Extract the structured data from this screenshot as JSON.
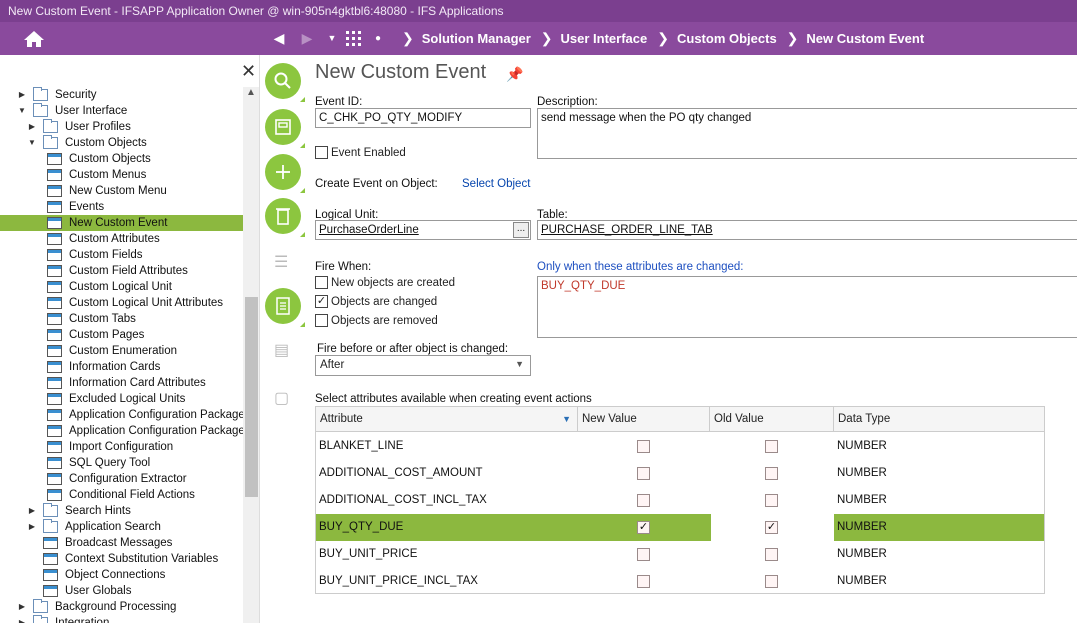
{
  "window": {
    "title": "New Custom Event - IFSAPP Application Owner @ win-905n4gktbl6:48080 - IFS Applications"
  },
  "nav": {
    "breadcrumbs": [
      "Solution Manager",
      "User Interface",
      "Custom Objects",
      "New Custom Event"
    ]
  },
  "tree": {
    "items": [
      {
        "label": "Security",
        "level": 1,
        "kind": "folder",
        "toggle": "▶"
      },
      {
        "label": "User Interface",
        "level": 1,
        "kind": "folder",
        "toggle": "▼"
      },
      {
        "label": "User Profiles",
        "level": 2,
        "kind": "folder",
        "toggle": "▶"
      },
      {
        "label": "Custom Objects",
        "level": 2,
        "kind": "folder",
        "toggle": "▼"
      },
      {
        "label": "Custom Objects",
        "level": 3,
        "kind": "page",
        "toggle": ""
      },
      {
        "label": "Custom Menus",
        "level": 3,
        "kind": "page",
        "toggle": ""
      },
      {
        "label": "New Custom Menu",
        "level": 3,
        "kind": "page",
        "toggle": ""
      },
      {
        "label": "Events",
        "level": 3,
        "kind": "page",
        "toggle": ""
      },
      {
        "label": "New Custom Event",
        "level": 3,
        "kind": "page",
        "toggle": "",
        "selected": true
      },
      {
        "label": "Custom Attributes",
        "level": 3,
        "kind": "page",
        "toggle": ""
      },
      {
        "label": "Custom Fields",
        "level": 3,
        "kind": "page",
        "toggle": ""
      },
      {
        "label": "Custom Field Attributes",
        "level": 3,
        "kind": "page",
        "toggle": ""
      },
      {
        "label": "Custom Logical Unit",
        "level": 3,
        "kind": "page",
        "toggle": ""
      },
      {
        "label": "Custom Logical Unit Attributes",
        "level": 3,
        "kind": "page",
        "toggle": ""
      },
      {
        "label": "Custom Tabs",
        "level": 3,
        "kind": "page",
        "toggle": ""
      },
      {
        "label": "Custom Pages",
        "level": 3,
        "kind": "page",
        "toggle": ""
      },
      {
        "label": "Custom Enumeration",
        "level": 3,
        "kind": "page",
        "toggle": ""
      },
      {
        "label": "Information Cards",
        "level": 3,
        "kind": "page",
        "toggle": ""
      },
      {
        "label": "Information Card Attributes",
        "level": 3,
        "kind": "page",
        "toggle": ""
      },
      {
        "label": "Excluded Logical Units",
        "level": 3,
        "kind": "page",
        "toggle": ""
      },
      {
        "label": "Application Configuration Package",
        "level": 3,
        "kind": "page",
        "toggle": ""
      },
      {
        "label": "Application Configuration Packages",
        "level": 3,
        "kind": "page",
        "toggle": ""
      },
      {
        "label": "Import Configuration",
        "level": 3,
        "kind": "page",
        "toggle": ""
      },
      {
        "label": "SQL Query Tool",
        "level": 3,
        "kind": "page",
        "toggle": ""
      },
      {
        "label": "Configuration Extractor",
        "level": 3,
        "kind": "page",
        "toggle": ""
      },
      {
        "label": "Conditional Field Actions",
        "level": 3,
        "kind": "page",
        "toggle": ""
      },
      {
        "label": "Search Hints",
        "level": 2,
        "kind": "folder",
        "toggle": "▶"
      },
      {
        "label": "Application Search",
        "level": 2,
        "kind": "folder",
        "toggle": "▶"
      },
      {
        "label": "Broadcast Messages",
        "level": 2,
        "kind": "page",
        "toggle": ""
      },
      {
        "label": "Context Substitution Variables",
        "level": 2,
        "kind": "page",
        "toggle": ""
      },
      {
        "label": "Object Connections",
        "level": 2,
        "kind": "page",
        "toggle": ""
      },
      {
        "label": "User Globals",
        "level": 2,
        "kind": "page",
        "toggle": ""
      },
      {
        "label": "Background Processing",
        "level": 1,
        "kind": "folder",
        "toggle": "▶"
      },
      {
        "label": "Integration",
        "level": 1,
        "kind": "folder",
        "toggle": "▶"
      }
    ]
  },
  "form": {
    "title": "New Custom Event",
    "event_id_label": "Event ID:",
    "event_id": "C_CHK_PO_QTY_MODIFY",
    "description_label": "Description:",
    "description": "send message when the PO qty changed",
    "event_enabled_label": "Event Enabled",
    "create_on_object_label": "Create Event on Object:",
    "select_object_link": "Select Object",
    "logical_unit_label": "Logical Unit:",
    "logical_unit": "PurchaseOrderLine",
    "lov_button": "...",
    "table_label": "Table:",
    "table": "PURCHASE_ORDER_LINE_TAB",
    "fire_when_label": "Fire When:",
    "fire_options": [
      {
        "label": "New objects are created",
        "checked": false
      },
      {
        "label": "Objects are changed",
        "checked": true
      },
      {
        "label": "Objects are removed",
        "checked": false
      }
    ],
    "only_when_label": "Only when these attributes are changed:",
    "only_when_value": "BUY_QTY_DUE",
    "fire_before_after_label": "Fire before or after object is changed:",
    "fire_before_after_value": "After",
    "attributes_label": "Select attributes available when creating event actions"
  },
  "grid": {
    "columns": [
      "Attribute",
      "New Value",
      "Old Value",
      "Data Type"
    ],
    "rows": [
      {
        "attribute": "BLANKET_LINE",
        "new": false,
        "old": false,
        "type": "NUMBER",
        "selected": false
      },
      {
        "attribute": "ADDITIONAL_COST_AMOUNT",
        "new": false,
        "old": false,
        "type": "NUMBER",
        "selected": false
      },
      {
        "attribute": "ADDITIONAL_COST_INCL_TAX",
        "new": false,
        "old": false,
        "type": "NUMBER",
        "selected": false
      },
      {
        "attribute": "BUY_QTY_DUE",
        "new": true,
        "old": true,
        "type": "NUMBER",
        "selected": true
      },
      {
        "attribute": "BUY_UNIT_PRICE",
        "new": false,
        "old": false,
        "type": "NUMBER",
        "selected": false
      },
      {
        "attribute": "BUY_UNIT_PRICE_INCL_TAX",
        "new": false,
        "old": false,
        "type": "NUMBER",
        "selected": false
      }
    ]
  },
  "colors": {
    "brand_purple": "#8a4a9d",
    "accent_green": "#8cb83f"
  }
}
